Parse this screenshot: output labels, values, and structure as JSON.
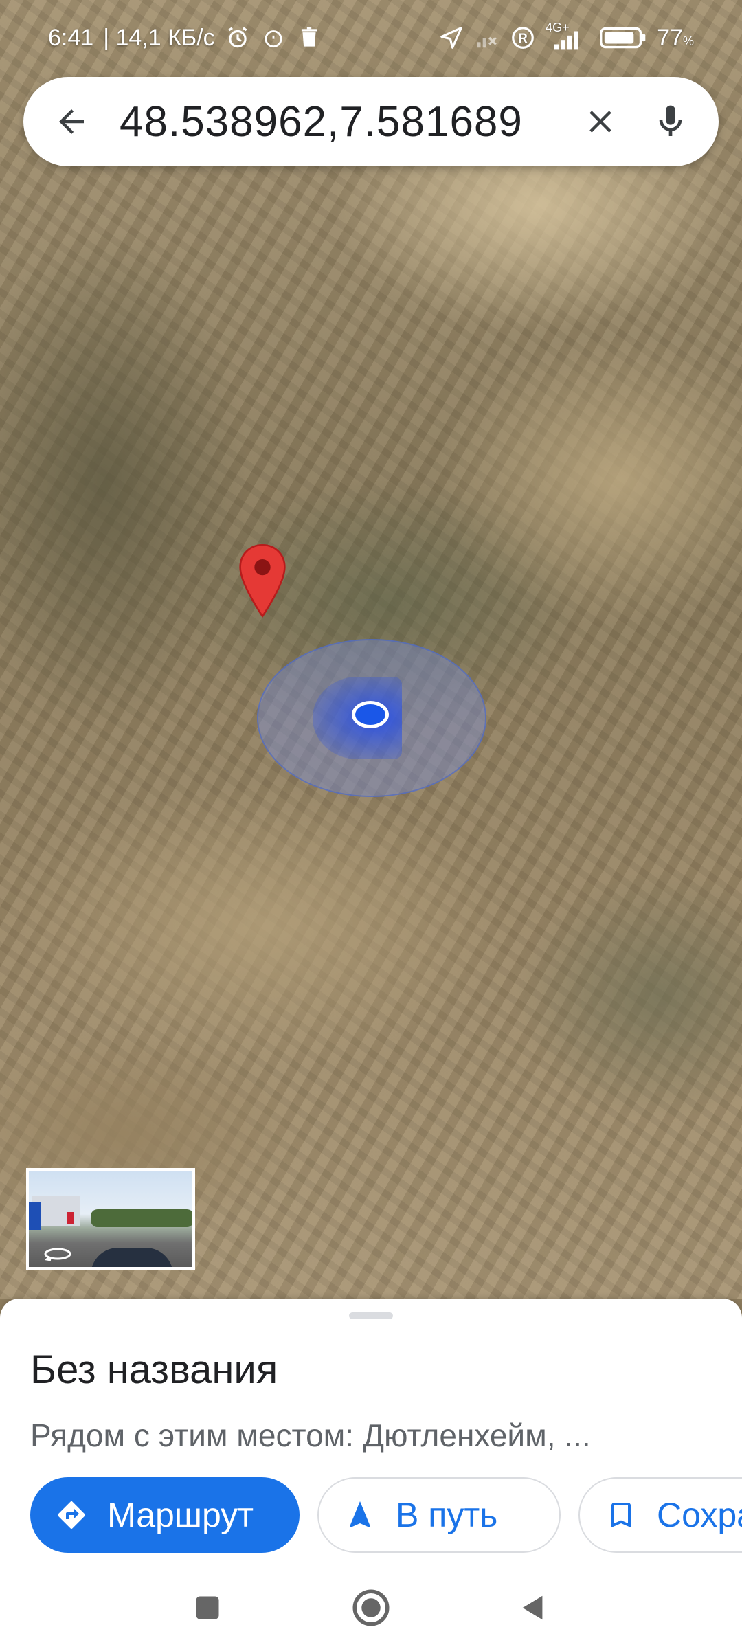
{
  "status_bar": {
    "time": "6:41",
    "speed": "| 14,1 КБ/с",
    "network_label": "4G+",
    "battery": "77",
    "battery_unit": "%",
    "icons": [
      "alarm-icon",
      "alarm-clock-icon",
      "trash-icon",
      "location-arrow-icon",
      "no-signal-icon",
      "roaming-icon",
      "signal-icon",
      "battery-icon"
    ]
  },
  "search": {
    "query": "48.538962,7.581689",
    "back_icon": "arrow-back-icon",
    "clear_icon": "close-icon",
    "voice_icon": "mic-icon"
  },
  "map": {
    "pin_color": "#e53935",
    "location_color": "#1a57e8"
  },
  "place": {
    "title": "Без названия",
    "nearby": "Рядом с этим местом: Дютленхейм, ..."
  },
  "actions": {
    "route_label": "Маршрут",
    "start_label": "В путь",
    "save_label": "Сохран",
    "accent": "#1a73e8"
  },
  "nav": {
    "icons": [
      "recents-square-icon",
      "home-circle-icon",
      "back-triangle-icon"
    ]
  }
}
